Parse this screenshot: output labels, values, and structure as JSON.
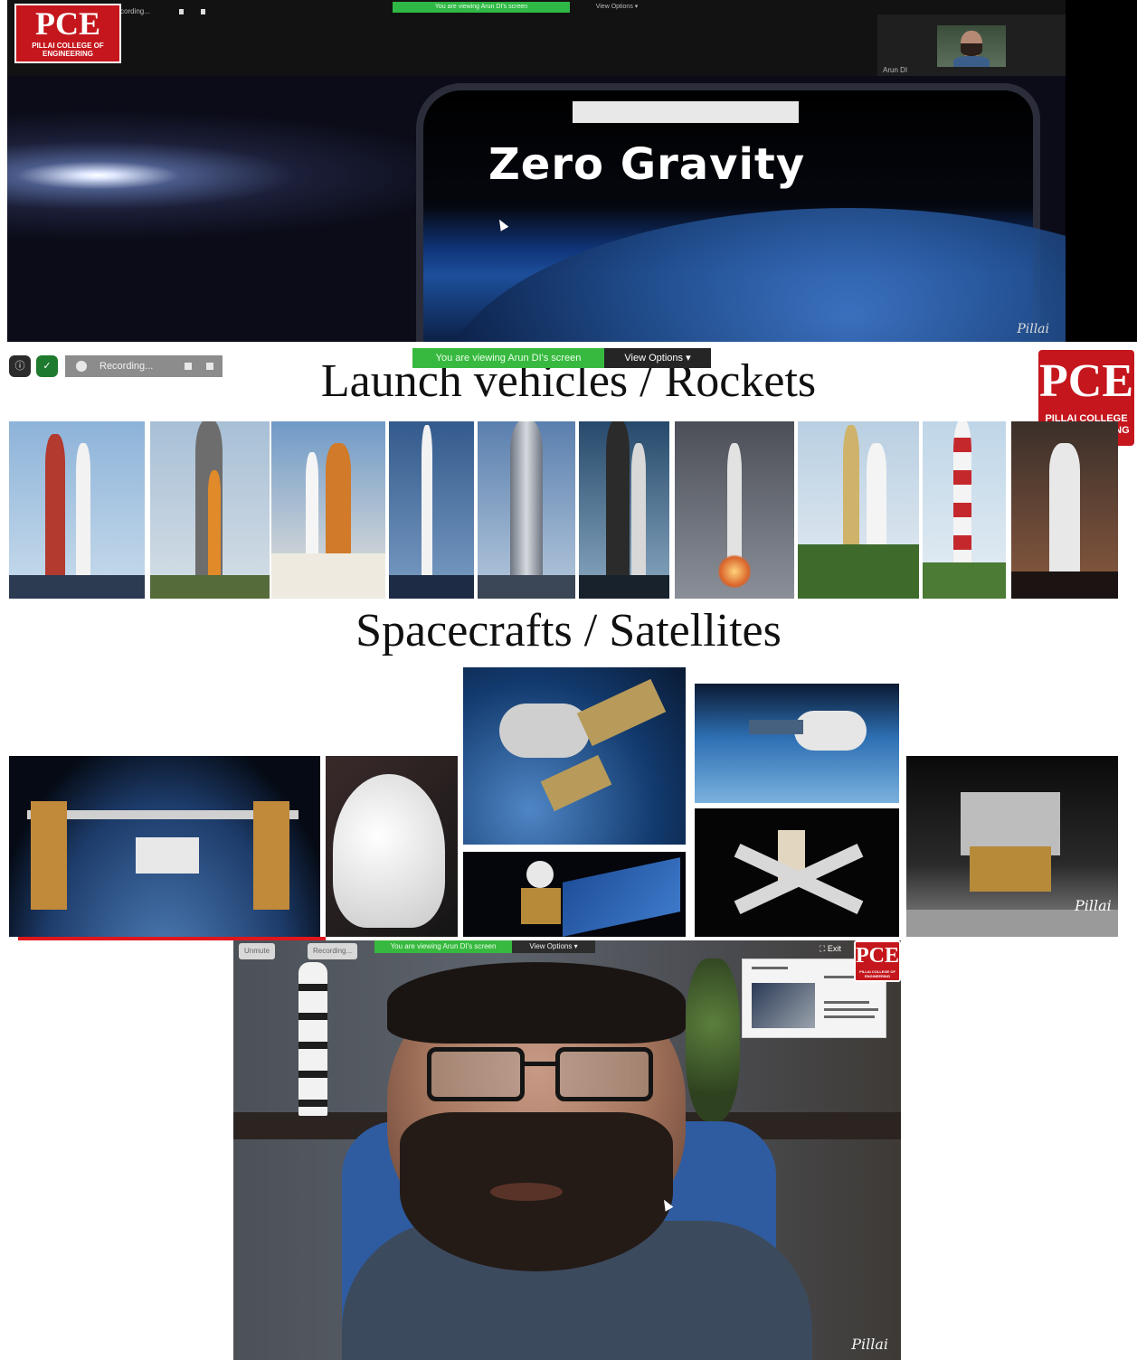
{
  "panel1": {
    "recording_label": "cording...",
    "viewing_banner": "You are viewing Arun DI's screen",
    "view_options": "View Options",
    "participant_name": "Arun DI",
    "slide_title": "Zero Gravity",
    "signature": "Pillai",
    "logo": {
      "letters": "PCE",
      "name": "PILLAI COLLEGE OF ENGINEERING"
    }
  },
  "panel2": {
    "recording_label": "Recording...",
    "viewing_banner": "You are viewing Arun DI's screen",
    "view_options": "View Options",
    "heading_launch": "Launch vehicles / Rockets",
    "heading_spacecraft": "Spacecrafts / Satellites",
    "signature": "Pillai",
    "logo": {
      "letters": "PCE",
      "name": "PILLAI COLLEGE OF ENGINEERING"
    },
    "rocket_images": [
      "Saturn V",
      "SLS",
      "Space Shuttle",
      "Falcon 9",
      "Starship",
      "Soyuz tower",
      "Soyuz launch",
      "Ariane",
      "PSLV",
      "GSLV"
    ],
    "spacecraft_images": [
      "ISS",
      "Crew Dragon",
      "Soyuz spacecraft",
      "Cargo module",
      "Satellite",
      "Skylab",
      "Lunar Module"
    ]
  },
  "panel3": {
    "unmute_label": "Unmute",
    "recording_label": "Recording...",
    "viewing_banner": "You are viewing Arun DI's screen",
    "view_options": "View Options",
    "exit_label": "Exit",
    "signature": "Pillai",
    "logo": {
      "letters": "PCE",
      "name": "PILLAI COLLEGE OF ENGINEERING"
    }
  },
  "colors": {
    "banner_green": "#37b93f",
    "pce_red": "#c4161c",
    "record_red": "#e0161c"
  }
}
